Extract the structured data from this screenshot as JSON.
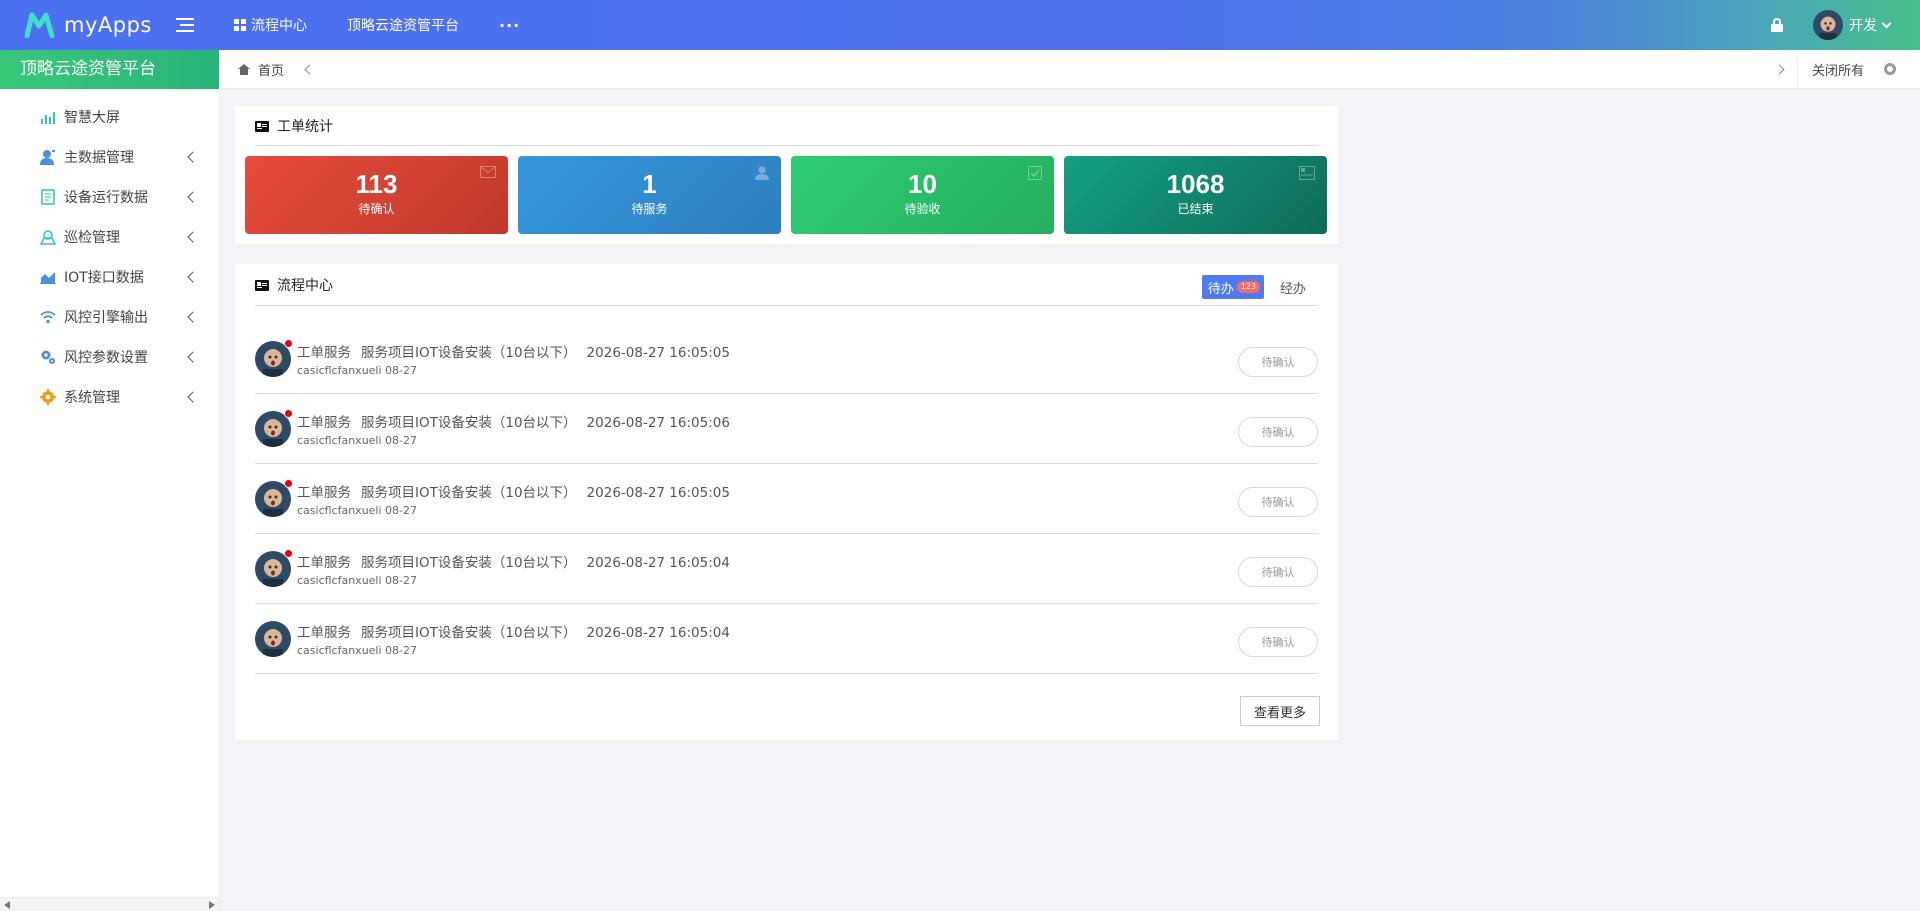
{
  "app": {
    "name": "myApps"
  },
  "topnav": {
    "items": [
      {
        "label": "流程中心"
      },
      {
        "label": "顶略云途资管平台"
      }
    ],
    "more": "···"
  },
  "user": {
    "name": "开发"
  },
  "sidebar": {
    "title": "顶略云途资管平台",
    "items": [
      {
        "label": "智慧大屏",
        "icon": "bar-chart-icon",
        "color": "#2ec7a9",
        "expandable": false
      },
      {
        "label": "主数据管理",
        "icon": "user-icon",
        "color": "#4a90e2",
        "expandable": true
      },
      {
        "label": "设备运行数据",
        "icon": "document-icon",
        "color": "#2ec7a9",
        "expandable": true
      },
      {
        "label": "巡检管理",
        "icon": "inspect-icon",
        "color": "#2ec7a9",
        "expandable": true
      },
      {
        "label": "IOT接口数据",
        "icon": "area-chart-icon",
        "color": "#4a90e2",
        "expandable": true
      },
      {
        "label": "风控引擎输出",
        "icon": "wifi-icon",
        "color": "#4a90e2",
        "expandable": true
      },
      {
        "label": "风控参数设置",
        "icon": "settings-icon",
        "color": "#4a90e2",
        "expandable": true
      },
      {
        "label": "系统管理",
        "icon": "gear-icon",
        "color": "#f39c12",
        "expandable": true
      }
    ]
  },
  "tabbar": {
    "home_label": "首页",
    "close_all": "关闭所有"
  },
  "stats_panel": {
    "title": "工单统计",
    "cards": [
      {
        "value": "113",
        "label": "待确认",
        "color": "#e74c3c",
        "icon": "mail-icon"
      },
      {
        "value": "1",
        "label": "待服务",
        "color": "#3498db",
        "icon": "person-icon"
      },
      {
        "value": "10",
        "label": "待验收",
        "color": "#2ecc71",
        "icon": "check-icon"
      },
      {
        "value": "1068",
        "label": "已结束",
        "color": "#16a085",
        "icon": "inbox-icon"
      }
    ]
  },
  "flow_panel": {
    "title": "流程中心",
    "tabs": {
      "active": "待办",
      "badge": "123",
      "other": "经办"
    },
    "rows": [
      {
        "type": "工单服务",
        "title": "服务项目IOT设备安装（10台以下）",
        "time": "2026-08-27 16:05:05",
        "sub": "casicflcfanxueli 08-27",
        "status": "待确认",
        "unread": true
      },
      {
        "type": "工单服务",
        "title": "服务项目IOT设备安装（10台以下）",
        "time": "2026-08-27 16:05:06",
        "sub": "casicflcfanxueli 08-27",
        "status": "待确认",
        "unread": true
      },
      {
        "type": "工单服务",
        "title": "服务项目IOT设备安装（10台以下）",
        "time": "2026-08-27 16:05:05",
        "sub": "casicflcfanxueli 08-27",
        "status": "待确认",
        "unread": true
      },
      {
        "type": "工单服务",
        "title": "服务项目IOT设备安装（10台以下）",
        "time": "2026-08-27 16:05:04",
        "sub": "casicflcfanxueli 08-27",
        "status": "待确认",
        "unread": true
      },
      {
        "type": "工单服务",
        "title": "服务项目IOT设备安装（10台以下）",
        "time": "2026-08-27 16:05:04",
        "sub": "casicflcfanxueli 08-27",
        "status": "待确认",
        "unread": false
      }
    ],
    "more_label": "查看更多"
  }
}
